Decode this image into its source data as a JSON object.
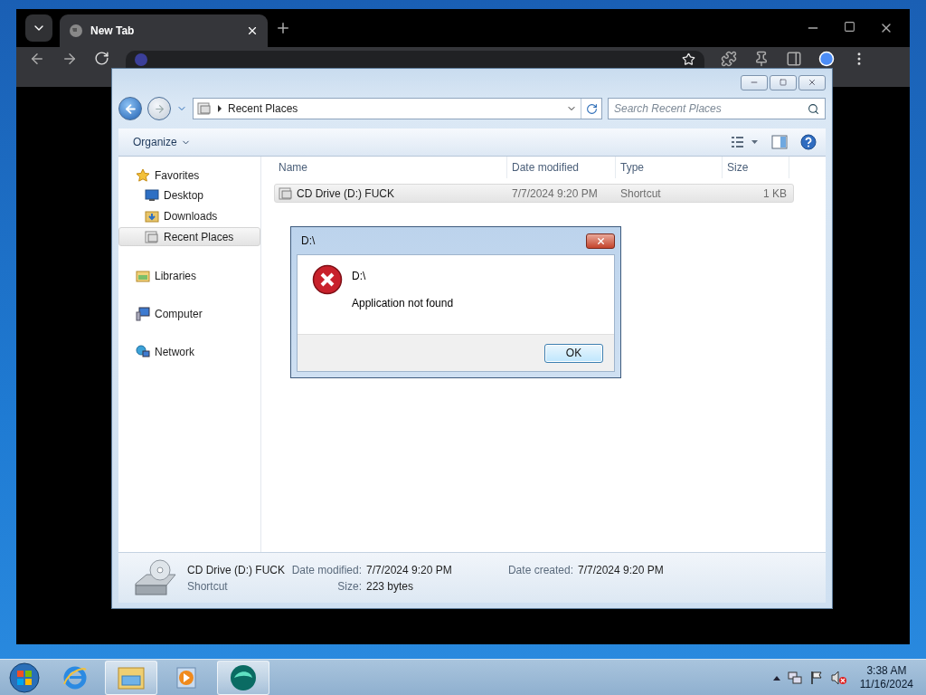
{
  "browser": {
    "tabs": [
      {
        "title": "New Tab",
        "selected": true
      }
    ]
  },
  "explorer": {
    "breadcrumb": "Recent Places",
    "search_placeholder": "Search Recent Places",
    "organize": "Organize",
    "nav": [
      {
        "label": "Favorites",
        "kind": "favorites",
        "selected": false,
        "children": [
          {
            "label": "Desktop",
            "kind": "desktop",
            "selected": false
          },
          {
            "label": "Downloads",
            "kind": "downloads",
            "selected": false
          },
          {
            "label": "Recent Places",
            "kind": "recent",
            "selected": true
          }
        ]
      },
      {
        "label": "Libraries",
        "kind": "libraries",
        "selected": false
      },
      {
        "label": "Computer",
        "kind": "computer",
        "selected": false
      },
      {
        "label": "Network",
        "kind": "network",
        "selected": false
      }
    ],
    "columns": [
      "Name",
      "Date modified",
      "Type",
      "Size"
    ],
    "rows": [
      {
        "name": "CD Drive (D:) FUCK",
        "date_modified": "7/7/2024 9:20 PM",
        "type": "Shortcut",
        "size": "1 KB",
        "selected": true
      }
    ],
    "details": {
      "name": "CD Drive (D:) FUCK",
      "type": "Shortcut",
      "modified": {
        "label": "Date modified:",
        "value": "7/7/2024 9:20 PM"
      },
      "size": {
        "label": "Size:",
        "value": "223 bytes"
      },
      "created": {
        "label": "Date created:",
        "value": "7/7/2024 9:20 PM"
      }
    }
  },
  "dialog": {
    "title": "D:\\",
    "heading": "D:\\",
    "message": "Application not found",
    "button": "OK"
  },
  "taskbar": {
    "apps": [
      {
        "kind": "ie",
        "active": false
      },
      {
        "kind": "explorer",
        "active": true
      },
      {
        "kind": "media",
        "active": false
      },
      {
        "kind": "app",
        "active": true
      }
    ],
    "time": "3:38 AM",
    "date": "11/16/2024"
  }
}
